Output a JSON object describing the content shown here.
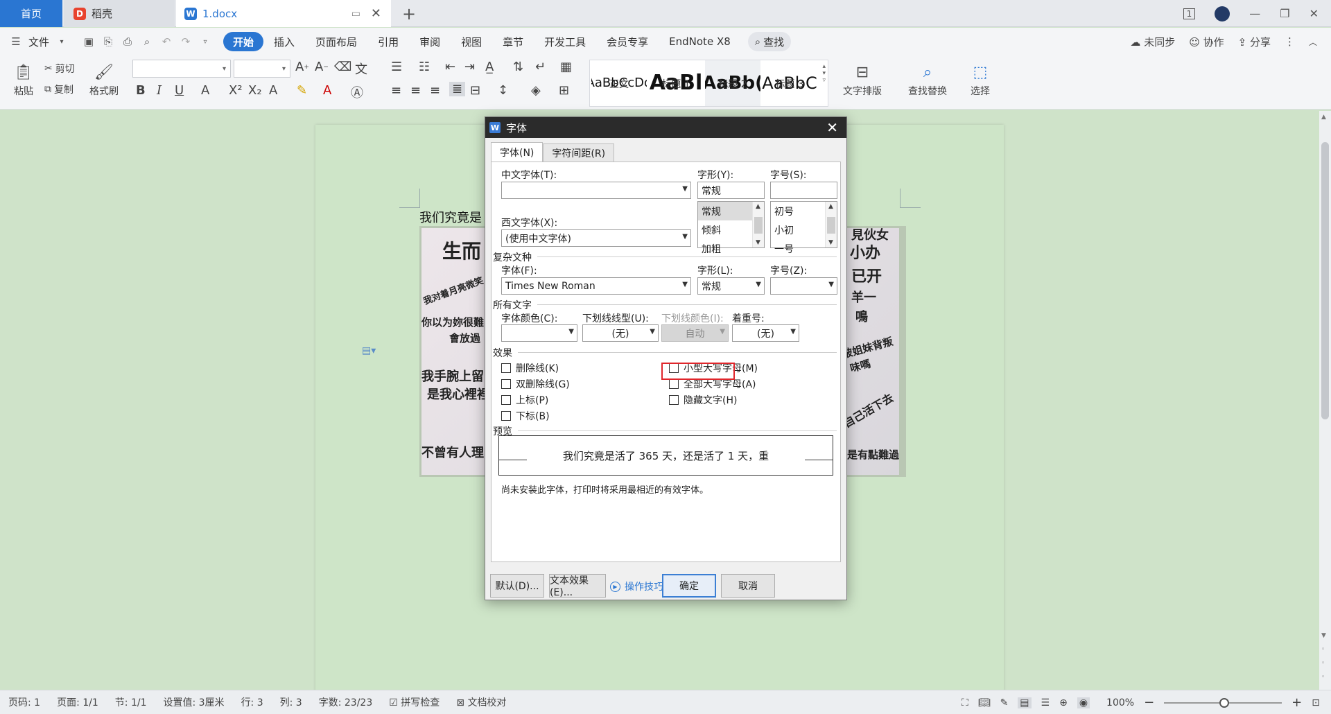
{
  "tabs": {
    "home": "首页",
    "daoke": "稻壳",
    "doc": "1.docx"
  },
  "window": {
    "page_indicator": "1"
  },
  "menu": {
    "file": "文件",
    "items": [
      "开始",
      "插入",
      "页面布局",
      "引用",
      "审阅",
      "视图",
      "章节",
      "开发工具",
      "会员专享",
      "EndNote X8"
    ],
    "search": "查找",
    "unsynced": "未同步",
    "collab": "协作",
    "share": "分享"
  },
  "ribbon": {
    "paste": "粘贴",
    "cut": "剪切",
    "copy": "复制",
    "format_painter": "格式刷",
    "styles": [
      {
        "preview": "AaBbCcDd",
        "label": "正文"
      },
      {
        "preview": "AaBl",
        "label": "标题 1"
      },
      {
        "preview": "AaBb(",
        "label": "标题 2"
      },
      {
        "preview": "AaBbC",
        "label": "标题 3"
      }
    ],
    "text_layout": "文字排版",
    "find_replace": "查找替换",
    "select": "选择"
  },
  "document": {
    "first_line": "我们究竟是",
    "image_texts": [
      "生而",
      "我对着月亮微笑",
      "你以为妳很難",
      "會放過",
      "我手腕上留",
      "是我心裡裡",
      "不曾有人理",
      "見伙女",
      "小办",
      "已开",
      "羊一",
      "鳴",
      "被姐妹背叛",
      "味嗎",
      "自己活下去",
      "是有點難過"
    ]
  },
  "dialog": {
    "title": "字体",
    "tabs": [
      "字体(N)",
      "字符间距(R)"
    ],
    "chinese_font_label": "中文字体(T):",
    "chinese_font_value": "",
    "style_label": "字形(Y):",
    "style_value": "常规",
    "style_options": [
      "常规",
      "倾斜",
      "加粗"
    ],
    "size_label": "字号(S):",
    "size_value": "",
    "size_options": [
      "初号",
      "小初",
      "一号"
    ],
    "western_font_label": "西文字体(X):",
    "western_font_value": "(使用中文字体)",
    "complex_section": "复杂文种",
    "complex_font_label": "字体(F):",
    "complex_font_value": "Times New Roman",
    "complex_style_label": "字形(L):",
    "complex_style_value": "常规",
    "complex_size_label": "字号(Z):",
    "complex_size_value": "",
    "all_text_section": "所有文字",
    "font_color_label": "字体颜色(C):",
    "underline_label": "下划线线型(U):",
    "underline_value": "(无)",
    "underline_color_label": "下划线颜色(I):",
    "underline_color_value": "自动",
    "emphasis_label": "着重号:",
    "emphasis_value": "(无)",
    "effects_section": "效果",
    "effects_left": [
      "删除线(K)",
      "双删除线(G)",
      "上标(P)",
      "下标(B)"
    ],
    "effects_right": [
      "小型大写字母(M)",
      "全部大写字母(A)",
      "隐藏文字(H)"
    ],
    "preview_section": "预览",
    "preview_text": "我们究竟是活了 365 天，还是活了 1 天，重",
    "font_note": "尚未安装此字体，打印时将采用最相近的有效字体。",
    "btn_default": "默认(D)...",
    "btn_text_effects": "文本效果(E)...",
    "tips": "操作技巧",
    "btn_ok": "确定",
    "btn_cancel": "取消"
  },
  "status": {
    "page_code": "页码: 1",
    "pages": "页面: 1/1",
    "section": "节: 1/1",
    "setting": "设置值: 3厘米",
    "row": "行: 3",
    "col": "列: 3",
    "word_count": "字数: 23/23",
    "spell_check": "拼写检查",
    "doc_proof": "文档校对",
    "zoom": "100%"
  },
  "colors": {
    "accent": "#2a76d2",
    "doc_background": "#cee5c8",
    "highlight_red": "#e0262b",
    "dialog_title_bar": "#2b2b2b"
  }
}
